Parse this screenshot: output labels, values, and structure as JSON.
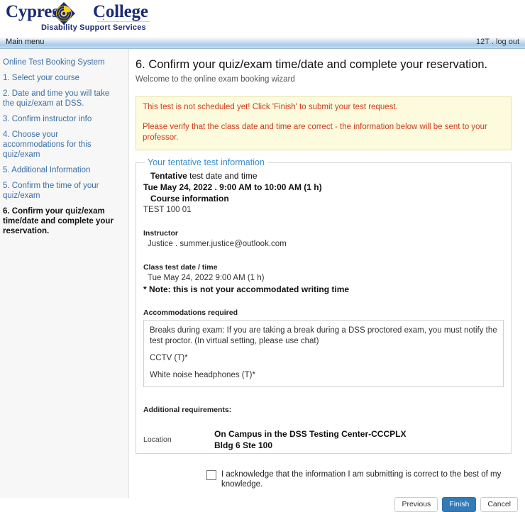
{
  "brand": {
    "word1": "Cypress",
    "word2": "College",
    "subtitle": "Disability Support Services",
    "dot": ".",
    "logo_icon": "cypress-college-diamond-swirl-logo",
    "navy": "#1b2b74",
    "gold": "#f5d020"
  },
  "menubar": {
    "main_menu": "Main menu",
    "user": "12T .",
    "logout": "log out"
  },
  "sidebar": {
    "items": [
      {
        "label": "Online Test Booking System",
        "current": false
      },
      {
        "label": "1. Select your course",
        "current": false
      },
      {
        "label": "2. Date and time you will take the quiz/exam at DSS.",
        "current": false
      },
      {
        "label": "3. Confirm instructor info",
        "current": false
      },
      {
        "label": "4. Choose your accommodations for this quiz/exam",
        "current": false
      },
      {
        "label": "5. Additional Information",
        "current": false
      },
      {
        "label": "5. Confirm the time of your quiz/exam",
        "current": false
      },
      {
        "label": "6. Confirm your quiz/exam time/date and complete your reservation.",
        "current": true
      }
    ]
  },
  "main": {
    "title": "6. Confirm your quiz/exam time/date and complete your reservation.",
    "subtitle": "Welcome to the online exam booking wizard",
    "alert": {
      "line1": "This test is not scheduled yet! Click 'Finish' to submit your test request.",
      "line2": "Please verify that the class date and time are correct - the information below will be sent to your professor.",
      "text_color": "#d03a1c",
      "bg_color": "#fdfbdd"
    },
    "fieldset": {
      "legend": "Your tentative test information",
      "legend_color": "#3a8fd0",
      "tentative_label_bold": "Tentative",
      "tentative_label_rest": " test date and time",
      "tentative_value": "Tue May 24, 2022 . 9:00 AM to 10:00 AM (1 h)",
      "course_label": "Course information",
      "course_value": "TEST 100 01",
      "instructor_label": "Instructor",
      "instructor_value": "Justice . summer.justice@outlook.com",
      "class_date_label": "Class test date / time",
      "class_date_value": "Tue May 24, 2022 9:00 AM (1 h)",
      "class_date_note": "* Note: this is not your accommodated writing time",
      "accommodations_label": "Accommodations required",
      "accommodations": [
        "Breaks during exam: If you are taking a break during a DSS proctored exam, you must notify the test proctor. (In virtual setting, please use chat)",
        "CCTV (T)*",
        "White noise headphones (T)*"
      ],
      "additional_requirements_label": "Additional requirements:",
      "location_label": "Location",
      "location_line1": "On Campus in the DSS Testing Center-CCCPLX",
      "location_line2": "Bldg 6 Ste 100"
    },
    "acknowledge_label": "I acknowledge that the information I am submitting is correct to the best of my knowledge.",
    "buttons": {
      "previous": "Previous",
      "finish": "Finish",
      "cancel": "Cancel",
      "primary_color": "#337ab7"
    }
  }
}
